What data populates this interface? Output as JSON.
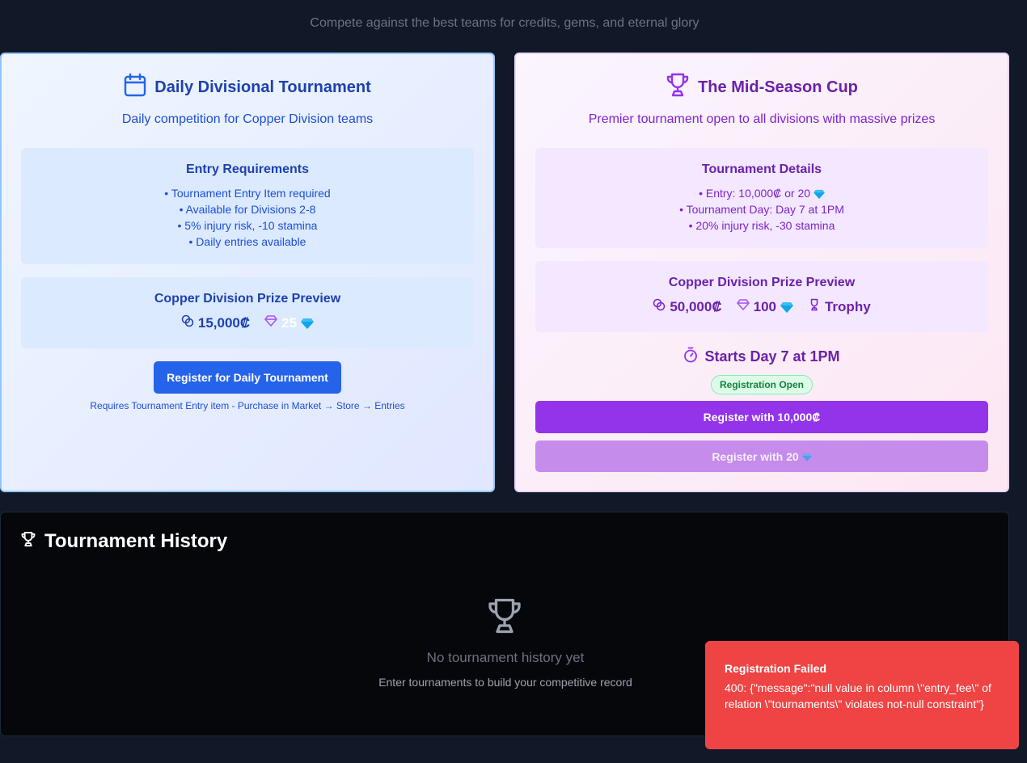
{
  "header": {
    "subtitle": "Compete against the best teams for credits, gems, and eternal glory"
  },
  "daily": {
    "title": "Daily Divisional Tournament",
    "description": "Daily competition for Copper Division teams",
    "requirements_title": "Entry Requirements",
    "requirements": [
      "• Tournament Entry Item required",
      "• Available for Divisions 2-8",
      "• 5% injury risk, -10 stamina",
      "• Daily entries available"
    ],
    "prize_title": "Copper Division Prize Preview",
    "prize_credits": "15,000₡",
    "prize_gems": "25",
    "register_label": "Register for Daily Tournament",
    "note": "Requires Tournament Entry item - Purchase in Market → Store → Entries",
    "accent_color": "#2563eb"
  },
  "cup": {
    "title": "The Mid-Season Cup",
    "description": "Premier tournament open to all divisions with massive prizes",
    "details_title": "Tournament Details",
    "details": [
      "• Entry: 10,000₡ or 20",
      "• Tournament Day: Day 7 at 1PM",
      "• 20% injury risk, -30 stamina"
    ],
    "prize_title": "Copper Division Prize Preview",
    "prize_credits": "50,000₡",
    "prize_gems": "100",
    "prize_trophy": "Trophy",
    "starts": "Starts Day 7 at 1PM",
    "status_badge": "Registration Open",
    "register_credits_label": "Register with 10,000₡",
    "register_gems_label": "Register with 20",
    "accent_color": "#9333ea"
  },
  "history": {
    "title": "Tournament History",
    "empty_title": "No tournament history yet",
    "empty_subtitle": "Enter tournaments to build your competitive record"
  },
  "toast": {
    "title": "Registration Failed",
    "message": "400: {\"message\":\"null value in column \\\"entry_fee\\\" of relation \\\"tournaments\\\" violates not-null constraint\"}",
    "color": "#ef4444"
  }
}
